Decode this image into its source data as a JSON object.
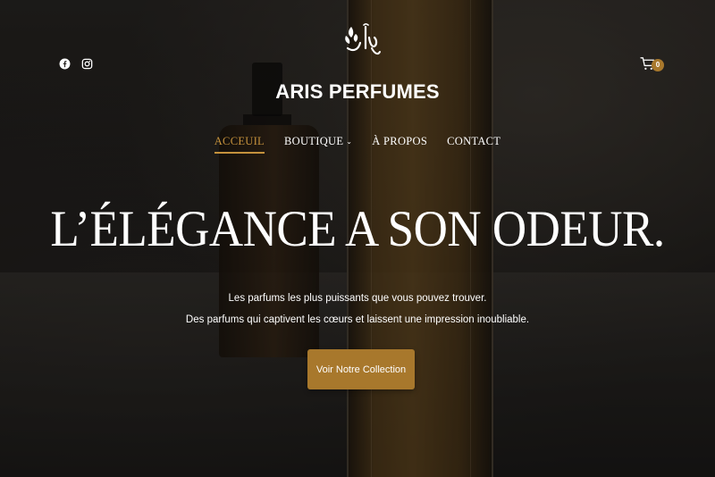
{
  "header": {
    "brand_name": "ARIS PERFUMES",
    "logo_icon": "arabic-calligraphy-logo",
    "social_icons": [
      "facebook-icon",
      "instagram-icon"
    ],
    "cart": {
      "icon": "cart-icon",
      "count": "0"
    }
  },
  "nav": {
    "items": [
      {
        "label": "ACCEUIL",
        "active": true
      },
      {
        "label": "BOUTIQUE",
        "has_dropdown": true
      },
      {
        "label": "À PROPOS"
      },
      {
        "label": "CONTACT"
      }
    ]
  },
  "hero": {
    "headline": "L’ÉLÉGANCE A SON ODEUR.",
    "subtext_line1": "Les parfums les plus puissants que vous pouvez trouver.",
    "subtext_line2": "Des parfums qui captivent les cœurs et laissent une impression inoubliable.",
    "cta_label": "Voir Notre Collection"
  },
  "colors": {
    "accent": "#a8782c",
    "nav_active": "#c4913c",
    "text": "#ffffff"
  }
}
